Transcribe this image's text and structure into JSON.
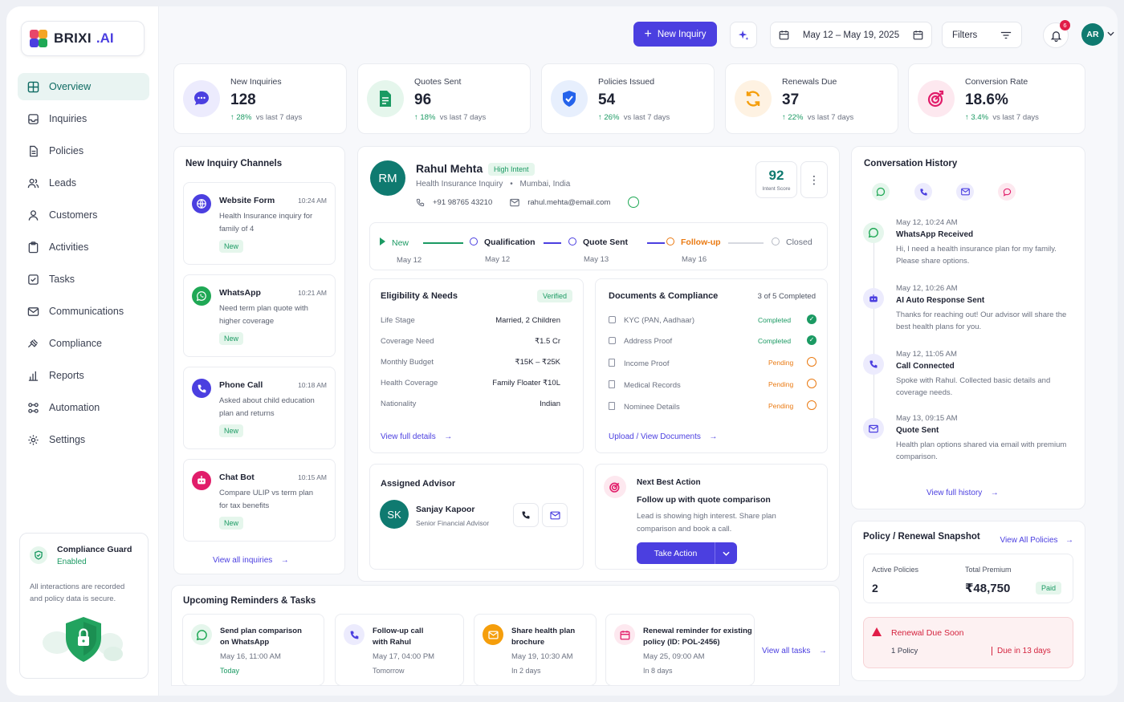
{
  "brand": {
    "name": "BRIXI",
    "suffix": ".AI"
  },
  "sidebar": {
    "items": [
      {
        "label": "Overview",
        "icon": "grid-icon"
      },
      {
        "label": "Inquiries",
        "icon": "inbox-icon"
      },
      {
        "label": "Policies",
        "icon": "document-icon"
      },
      {
        "label": "Leads",
        "icon": "users-icon"
      },
      {
        "label": "Customers",
        "icon": "user-icon"
      },
      {
        "label": "Activities",
        "icon": "clipboard-icon"
      },
      {
        "label": "Tasks",
        "icon": "checkbox-icon"
      },
      {
        "label": "Communications",
        "icon": "mail-icon"
      },
      {
        "label": "Compliance",
        "icon": "gavel-icon"
      },
      {
        "label": "Reports",
        "icon": "bar-chart-icon"
      },
      {
        "label": "Automation",
        "icon": "workflow-icon"
      },
      {
        "label": "Settings",
        "icon": "gear-icon"
      }
    ],
    "guard": {
      "title": "Compliance Guard",
      "status": "Enabled",
      "desc": "All interactions are recorded and policy data is secure."
    }
  },
  "topbar": {
    "new_inquiry": "New Inquiry",
    "date_range": "May 12 – May 19, 2025",
    "filters": "Filters",
    "notifications": "6",
    "avatar": "AR"
  },
  "kpis": [
    {
      "label": "New Inquiries",
      "value": "128",
      "change": "28%",
      "compare": "vs last 7 days",
      "color": "#4b3fe0",
      "bg": "#ecebfd"
    },
    {
      "label": "Quotes Sent",
      "value": "96",
      "change": "18%",
      "compare": "vs last 7 days",
      "color": "#1b9a63",
      "bg": "#e5f6ec"
    },
    {
      "label": "Policies Issued",
      "value": "54",
      "change": "26%",
      "compare": "vs last 7 days",
      "color": "#2563eb",
      "bg": "#e7effd"
    },
    {
      "label": "Renewals Due",
      "value": "37",
      "change": "22%",
      "compare": "vs last 7 days",
      "color": "#f59e0b",
      "bg": "#fef2e2"
    },
    {
      "label": "Conversion Rate",
      "value": "18.6%",
      "change": "3.4%",
      "compare": "vs last 7 days",
      "color": "#e11d6a",
      "bg": "#fde8ef"
    }
  ],
  "channels": {
    "title": "New Inquiry Channels",
    "items": [
      {
        "name": "Website Form",
        "time": "10:24 AM",
        "desc": "Health Insurance inquiry for family of 4",
        "badge": "New",
        "color": "#4b3fe0"
      },
      {
        "name": "WhatsApp",
        "time": "10:21 AM",
        "desc": "Need term plan quote with higher coverage",
        "badge": "New",
        "color": "#1fa855"
      },
      {
        "name": "Phone Call",
        "time": "10:18 AM",
        "desc": "Asked about child education plan and returns",
        "badge": "New",
        "color": "#4b3fe0"
      },
      {
        "name": "Chat Bot",
        "time": "10:15 AM",
        "desc": "Compare ULIP vs term plan for tax benefits",
        "badge": "New",
        "color": "#e11d6a"
      }
    ],
    "view_all": "View all inquiries"
  },
  "lead": {
    "initials": "RM",
    "name": "Rahul Mehta",
    "intent": "High Intent",
    "type": "Health Insurance Inquiry",
    "location": "Mumbai, India",
    "phone": "+91 98765 43210",
    "email": "rahul.mehta@email.com",
    "score": "92",
    "score_label": "Intent Score",
    "stages": [
      {
        "label": "New",
        "date": "May 12"
      },
      {
        "label": "Qualification",
        "date": "May 12"
      },
      {
        "label": "Quote Sent",
        "date": "May 13"
      },
      {
        "label": "Follow-up",
        "date": "May 16"
      },
      {
        "label": "Closed",
        "date": ""
      }
    ]
  },
  "eligibility": {
    "title": "Eligibility & Needs",
    "badge": "Verified",
    "rows": [
      {
        "k": "Life Stage",
        "v": "Married, 2 Children"
      },
      {
        "k": "Coverage Need",
        "v": "₹1.5 Cr"
      },
      {
        "k": "Monthly Budget",
        "v": "₹15K – ₹25K"
      },
      {
        "k": "Health Coverage",
        "v": "Family Floater ₹10L"
      },
      {
        "k": "Nationality",
        "v": "Indian"
      }
    ],
    "link": "View full details"
  },
  "documents": {
    "title": "Documents & Compliance",
    "progress": "3 of 5 Completed",
    "rows": [
      {
        "k": "KYC (PAN, Aadhaar)",
        "v": "Completed"
      },
      {
        "k": "Address Proof",
        "v": "Completed"
      },
      {
        "k": "Income Proof",
        "v": "Pending"
      },
      {
        "k": "Medical Records",
        "v": "Pending"
      },
      {
        "k": "Nominee Details",
        "v": "Pending"
      }
    ],
    "link": "Upload / View Documents"
  },
  "advisor": {
    "title": "Assigned Advisor",
    "initials": "SK",
    "name": "Sanjay Kapoor",
    "role": "Senior Financial Advisor"
  },
  "nba": {
    "title": "Next Best Action",
    "action": "Follow up with quote comparison",
    "desc": "Lead is showing high interest. Share plan comparison and book a call.",
    "button": "Take Action"
  },
  "history": {
    "title": "Conversation History",
    "items": [
      {
        "time": "May 12, 10:24 AM",
        "title": "WhatsApp Received",
        "desc": "Hi, I need a health insurance plan for my family. Please share options."
      },
      {
        "time": "May 12, 10:26 AM",
        "title": "AI Auto Response Sent",
        "desc": "Thanks for reaching out! Our advisor will share the best health plans for you."
      },
      {
        "time": "May 12, 11:05 AM",
        "title": "Call Connected",
        "desc": "Spoke with Rahul. Collected basic details and coverage needs."
      },
      {
        "time": "May 13, 09:15 AM",
        "title": "Quote Sent",
        "desc": "Health plan options shared via email with premium comparison."
      }
    ],
    "link": "View full history"
  },
  "snapshot": {
    "title": "Policy / Renewal Snapshot",
    "link": "View All Policies",
    "active_label": "Active Policies",
    "active": "2",
    "premium_label": "Total Premium",
    "premium": "₹48,750",
    "paid": "Paid",
    "renewal_title": "Renewal Due Soon",
    "renewal_count": "1 Policy",
    "renewal_due": "Due in 13 days"
  },
  "reminders": {
    "title": "Upcoming Reminders & Tasks",
    "items": [
      {
        "title1": "Send plan comparison",
        "title2": "on WhatsApp",
        "date": "May 16, 11:00 AM",
        "when": "Today"
      },
      {
        "title1": "Follow-up call",
        "title2": "with Rahul",
        "date": "May 17, 04:00 PM",
        "when": "Tomorrow"
      },
      {
        "title1": "Share health plan",
        "title2": "brochure",
        "date": "May 19, 10:30 AM",
        "when": "In 2 days"
      },
      {
        "title1": "Renewal reminder for existing",
        "title2": "policy (ID: POL-2456)",
        "date": "May 25, 09:00 AM",
        "when": "In 8 days"
      }
    ],
    "link": "View all tasks"
  }
}
